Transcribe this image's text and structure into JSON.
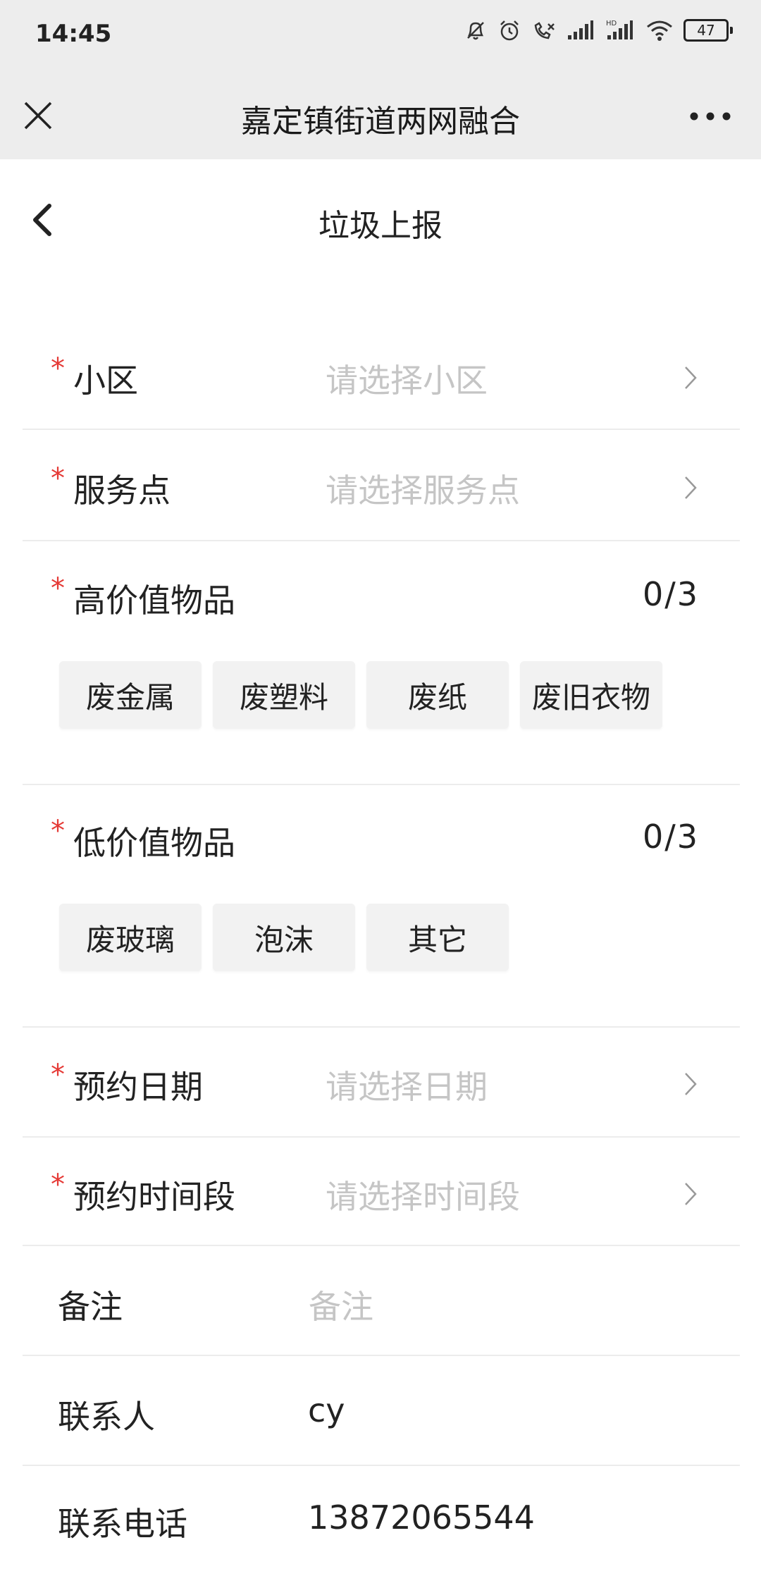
{
  "status_bar": {
    "time": "14:45",
    "battery": "47"
  },
  "wechat_bar": {
    "title": "嘉定镇街道两网融合"
  },
  "header": {
    "title": "垃圾上报"
  },
  "form": {
    "required_mark": "*",
    "community": {
      "label": "小区",
      "placeholder": "请选择小区"
    },
    "service_point": {
      "label": "服务点",
      "placeholder": "请选择服务点"
    },
    "high_value": {
      "label": "高价值物品",
      "count": "0/3",
      "options": [
        "废金属",
        "废塑料",
        "废纸",
        "废旧衣物"
      ]
    },
    "low_value": {
      "label": "低价值物品",
      "count": "0/3",
      "options": [
        "废玻璃",
        "泡沫",
        "其它"
      ]
    },
    "date": {
      "label": "预约日期",
      "placeholder": "请选择日期"
    },
    "time_slot": {
      "label": "预约时间段",
      "placeholder": "请选择时间段"
    },
    "remark": {
      "label": "备注",
      "placeholder": "备注"
    },
    "contact": {
      "label": "联系人",
      "value": "cy"
    },
    "phone": {
      "label": "联系电话",
      "value": "13872065544"
    }
  },
  "colors": {
    "required": "#e53935",
    "placeholder": "#c5c5c5",
    "bar_bg": "#ededed",
    "tag_bg": "#f2f2f2"
  }
}
